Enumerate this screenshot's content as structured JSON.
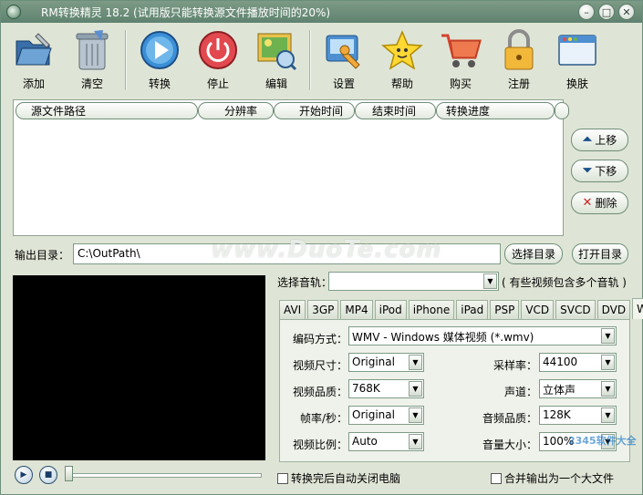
{
  "window": {
    "title": "RM转换精灵 18.2 (试用版只能转换源文件播放时间的20%)",
    "controls": [
      "minimize",
      "maximize",
      "close"
    ]
  },
  "toolbar": {
    "add": "添加",
    "clear": "清空",
    "convert": "转换",
    "stop": "停止",
    "edit": "编辑",
    "settings": "设置",
    "help": "帮助",
    "buy": "购买",
    "register": "注册",
    "skin": "换肤"
  },
  "list": {
    "columns": [
      "源文件路径",
      "分辨率",
      "开始时间",
      "结束时间",
      "转换进度"
    ]
  },
  "side_buttons": {
    "up": "上移",
    "down": "下移",
    "delete": "删除"
  },
  "output": {
    "label": "输出目录：",
    "value": "C:\\OutPath\\",
    "browse": "选择目录",
    "open": "打开目录"
  },
  "watermark": "www.DuoTe.com",
  "audio_track": {
    "label": "选择音轨：",
    "value": "",
    "note": "( 有些视频包含多个音轨 )"
  },
  "formats": {
    "tabs": [
      "AVI",
      "3GP",
      "MP4",
      "iPod",
      "iPhone",
      "iPad",
      "PSP",
      "VCD",
      "SVCD",
      "DVD",
      "WMV"
    ],
    "active": "WMV"
  },
  "settings": {
    "codec_label": "编码方式：",
    "codec_value": "WMV - Windows 媒体视频 (*.wmv)",
    "video_size_label": "视频尺寸：",
    "video_size_value": "Original",
    "video_quality_label": "视频品质：",
    "video_quality_value": "768K",
    "framerate_label": "帧率/秒：",
    "framerate_value": "Original",
    "aspect_label": "视频比例：",
    "aspect_value": "Auto",
    "samplerate_label": "采样率：",
    "samplerate_value": "44100",
    "channel_label": "声道：",
    "channel_value": "立体声",
    "audio_quality_label": "音频品质：",
    "audio_quality_value": "128K",
    "volume_label": "音量大小：",
    "volume_value": "100%"
  },
  "bottom": {
    "shutdown_label": "转换完后自动关闭电脑",
    "merge_label": "合并输出为一个大文件"
  },
  "corner_logo": "2345软件大全"
}
